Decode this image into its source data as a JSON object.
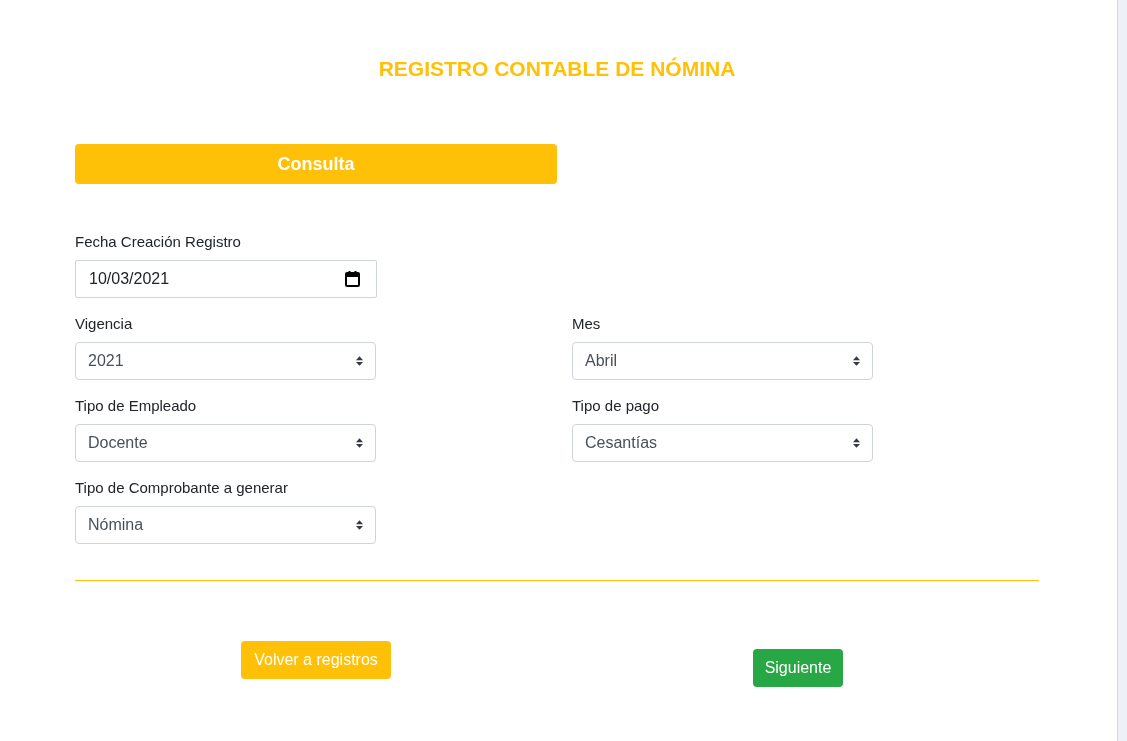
{
  "title": "REGISTRO CONTABLE DE NÓMINA",
  "section_button": "Consulta",
  "rows": [
    [
      {
        "kind": "date",
        "label": "Fecha Creación Registro",
        "value": "10/03/2021"
      }
    ],
    [
      {
        "kind": "select",
        "label": "Vigencia",
        "value": "2021"
      },
      {
        "kind": "select",
        "label": "Mes",
        "value": "Abril"
      }
    ],
    [
      {
        "kind": "select",
        "label": "Tipo de Empleado",
        "value": "Docente"
      },
      {
        "kind": "select",
        "label": "Tipo de pago",
        "value": "Cesantías"
      }
    ],
    [
      {
        "kind": "select",
        "label": "Tipo de Comprobante a generar",
        "value": "Nómina"
      }
    ]
  ],
  "buttons": [
    {
      "kind": "warning",
      "label": "Volver a registros"
    },
    {
      "kind": "success",
      "label": "Siguiente"
    }
  ]
}
